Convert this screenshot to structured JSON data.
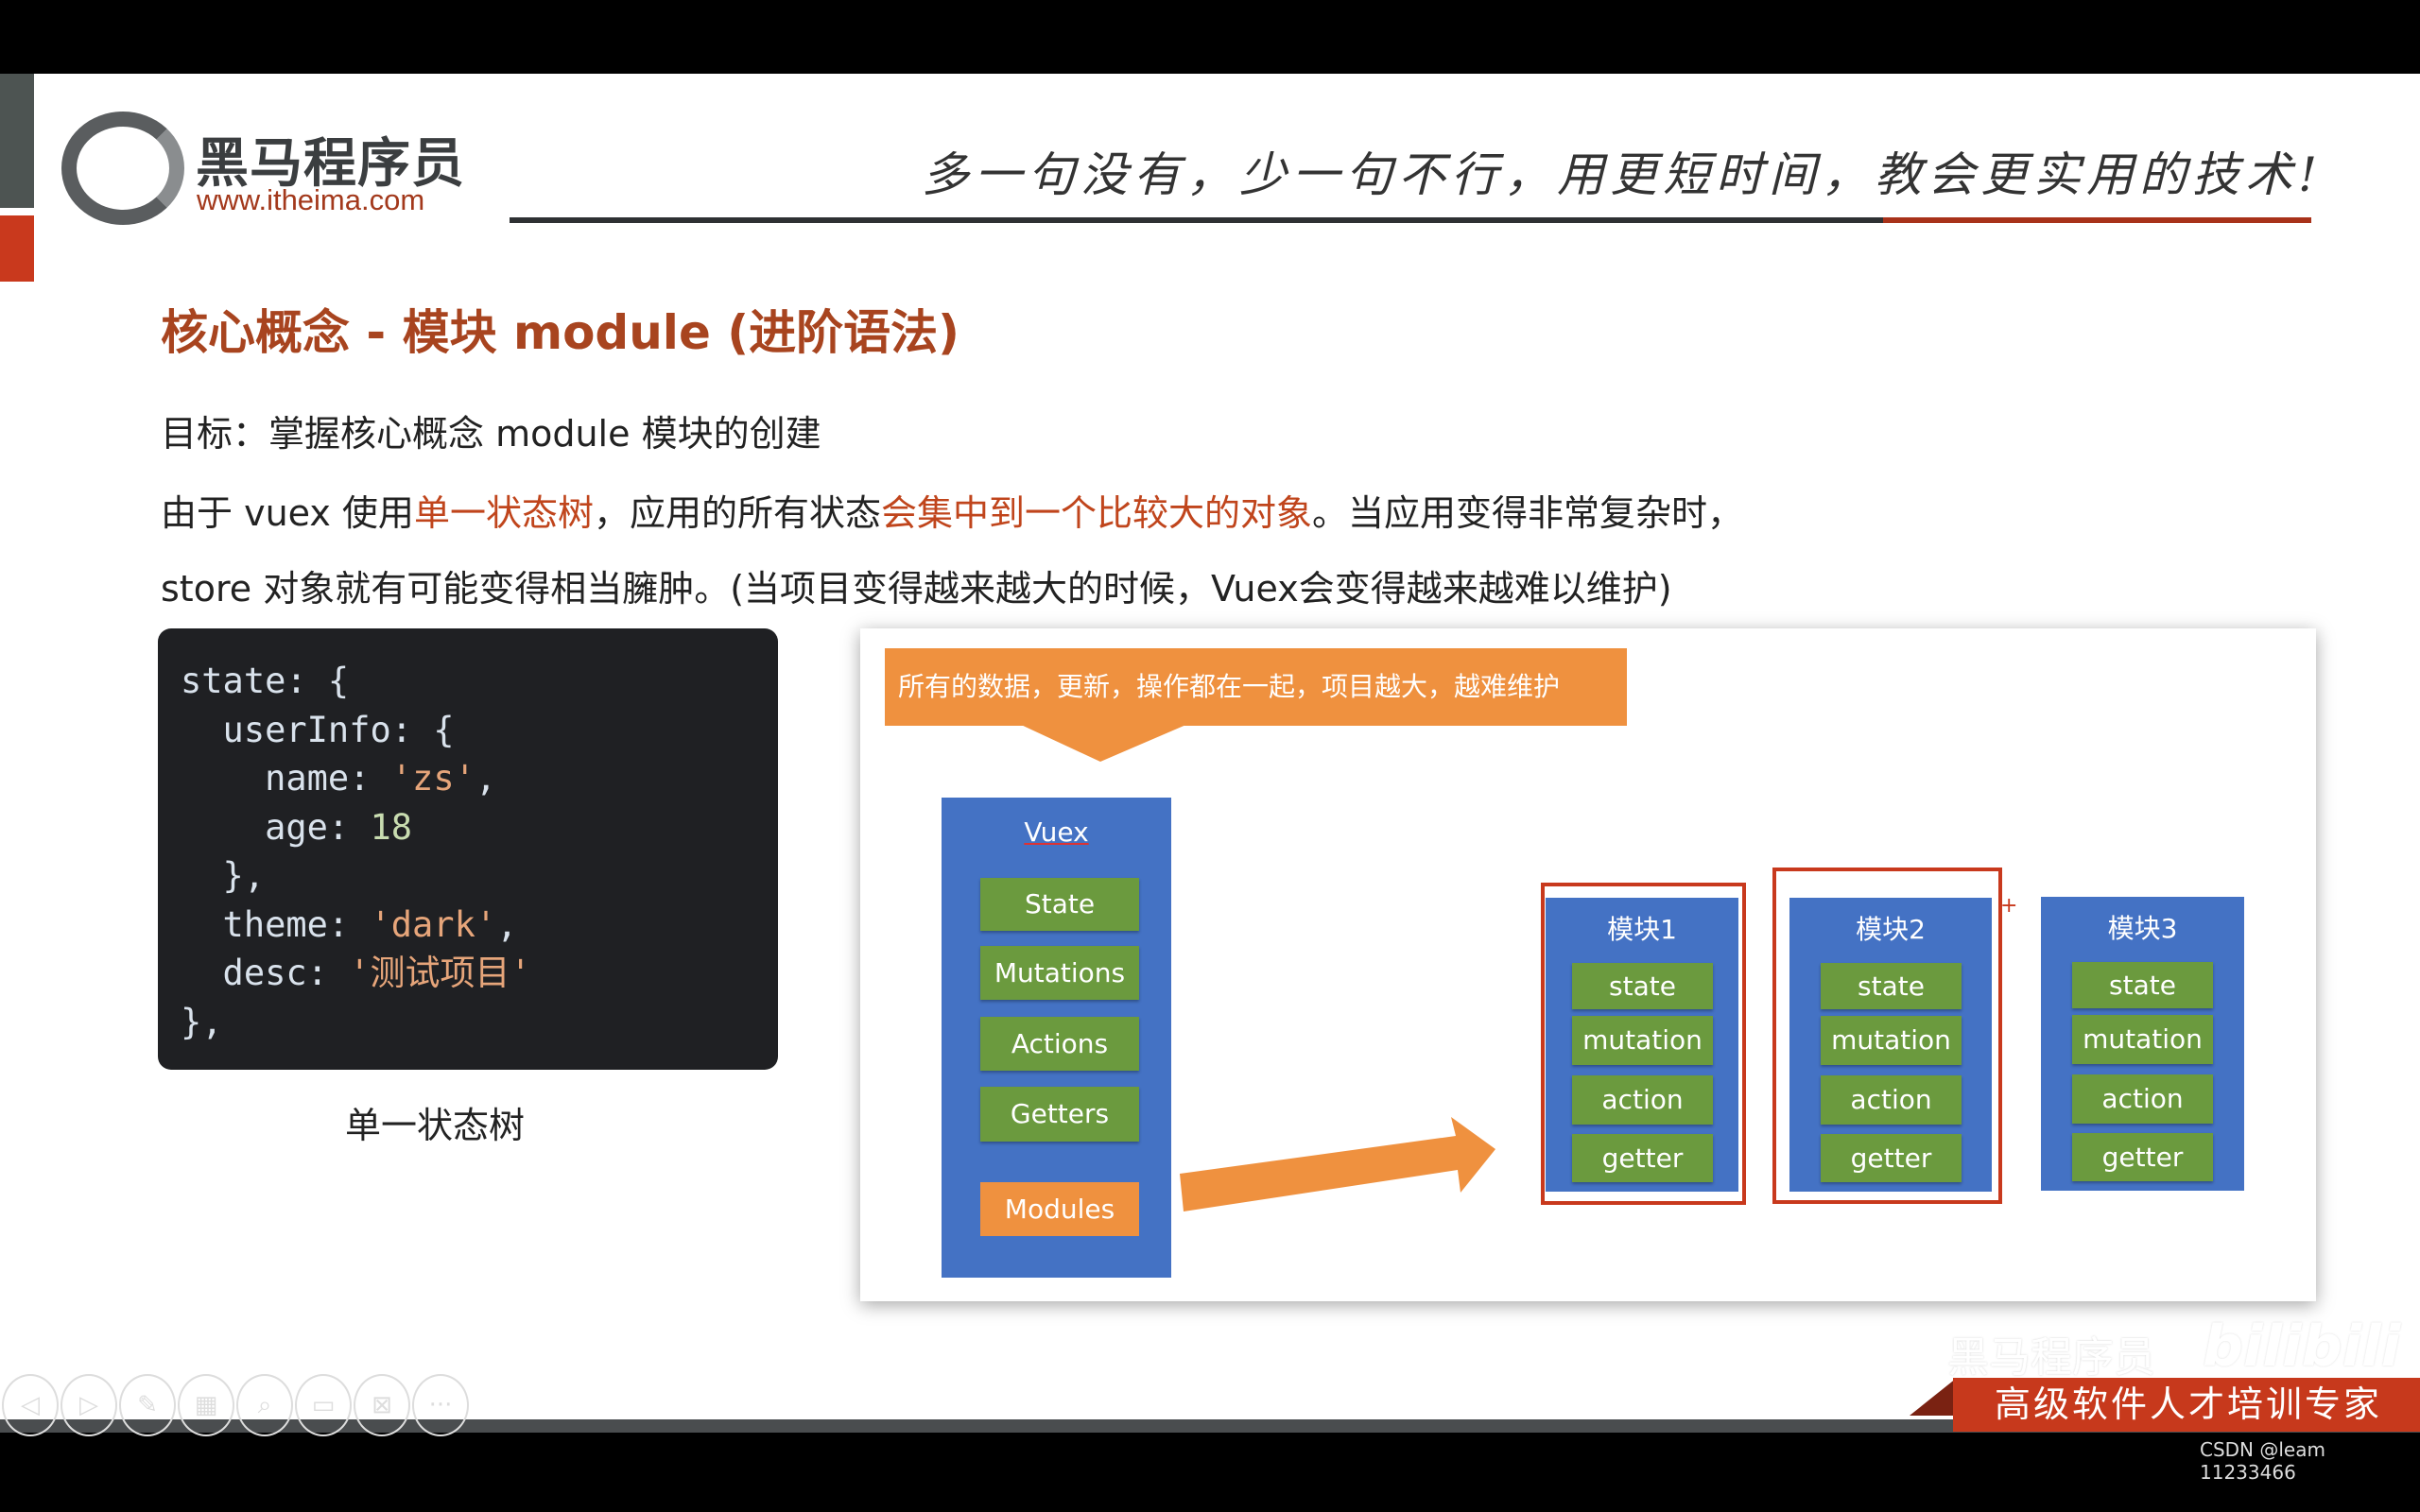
{
  "header": {
    "logo_name": "黑马程序员",
    "logo_url": "www.itheima.com",
    "slogan": "多一句没有，少一句不行，用更短时间，教会更实用的技术!"
  },
  "title": "核心概念 - 模块 module (进阶语法)",
  "goal": "目标：掌握核心概念 module 模块的创建",
  "paragraph": {
    "l1a": "由于 vuex 使用",
    "l1b": "单一状态树",
    "l1c": "，应用的所有状态",
    "l1d": "会集中到一个比较大的对象",
    "l1e": "。当应用变得非常复杂时，",
    "l2": "store 对象就有可能变得相当臃肿。(当项目变得越来越大的时候，Vuex会变得越来越难以维护)"
  },
  "code": {
    "lines": [
      "state: {",
      "  userInfo: {",
      "    name: ",
      "'zs'",
      ",",
      "    age: ",
      "18",
      "  },",
      "  theme: ",
      "'dark'",
      ",",
      "  desc: ",
      "'测试项目'",
      "},"
    ]
  },
  "caption": "单一状态树",
  "diagram": {
    "callout": "所有的数据，更新，操作都在一起，项目越大，越难维护",
    "vuex": {
      "title": "Vuex",
      "items": [
        "State",
        "Mutations",
        "Actions",
        "Getters"
      ],
      "modules": "Modules"
    },
    "modules": [
      {
        "title": "模块1",
        "items": [
          "state",
          "mutation",
          "action",
          "getter"
        ],
        "highlighted": true
      },
      {
        "title": "模块2",
        "items": [
          "state",
          "mutation",
          "action",
          "getter"
        ],
        "highlighted": true
      },
      {
        "title": "模块3",
        "items": [
          "state",
          "mutation",
          "action",
          "getter"
        ],
        "highlighted": false
      }
    ],
    "colors": {
      "blue": "#4472c4",
      "green": "#6b9a3e",
      "orange": "#ef913f",
      "highlight": "#c8391d"
    }
  },
  "footer": {
    "ribbon": "高级软件人才培训专家",
    "watermark_logo": "黑马程序员",
    "watermark_site": "bilibili",
    "credit": "CSDN @leam 11233466"
  },
  "toolbar": {
    "icons": [
      "previous-icon",
      "next-icon",
      "pen-icon",
      "slides-icon",
      "zoom-icon",
      "screen-icon",
      "hide-icon",
      "more-icon"
    ],
    "glyphs": [
      "◁",
      "▷",
      "✎",
      "▦",
      "⌕",
      "▭",
      "⊠",
      "···"
    ]
  }
}
